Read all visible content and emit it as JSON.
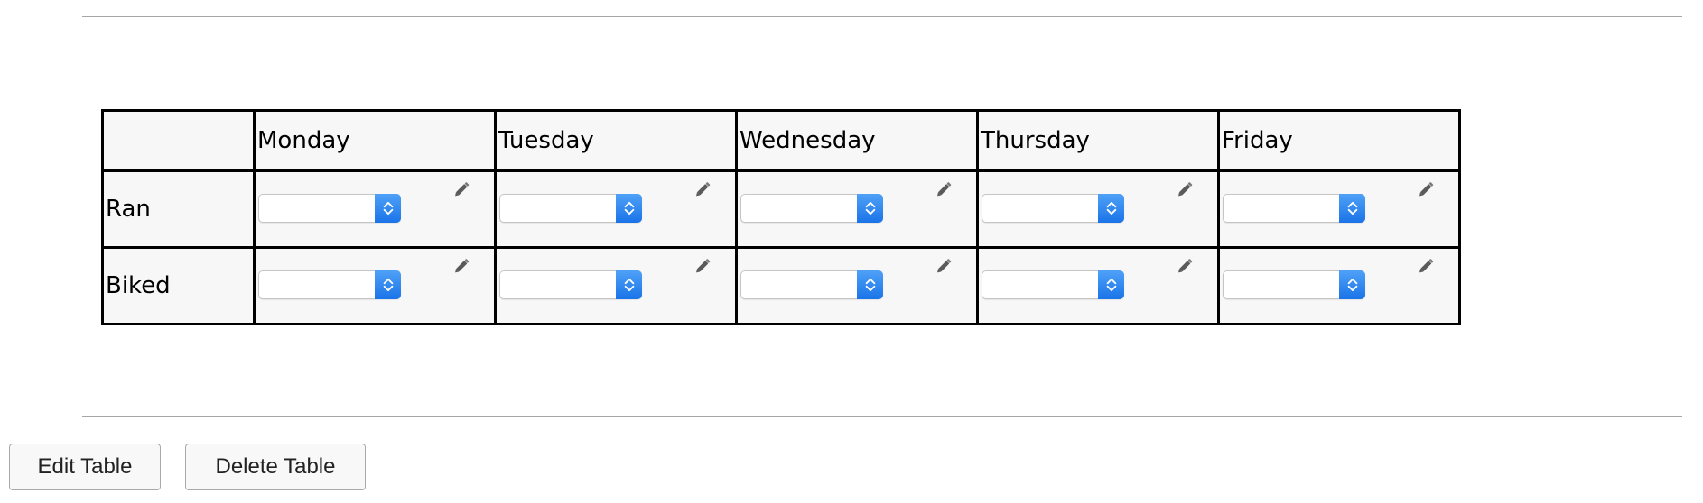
{
  "table": {
    "corner_label": "",
    "days": [
      "Monday",
      "Tuesday",
      "Wednesday",
      "Thursday",
      "Friday"
    ],
    "rows": [
      {
        "label": "Ran",
        "values": [
          "",
          "",
          "",
          "",
          ""
        ]
      },
      {
        "label": "Biked",
        "values": [
          "",
          "",
          "",
          "",
          ""
        ]
      }
    ],
    "edit_icon": "pencil-icon",
    "select_icon": "chevron-up-down-icon"
  },
  "buttons": {
    "edit_table": "Edit Table",
    "delete_table": "Delete Table"
  },
  "colors": {
    "table_background": "#f7f7f7",
    "select_accent": "#2f86f0",
    "divider": "#a6a6a6"
  }
}
